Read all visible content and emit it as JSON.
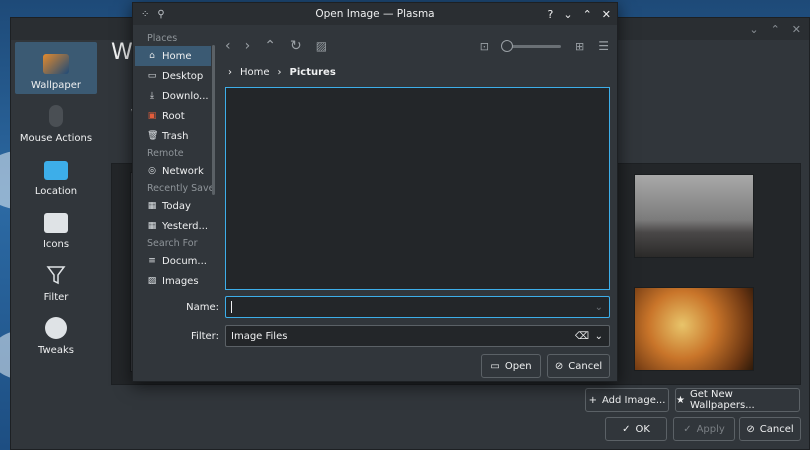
{
  "dialog": {
    "title": "Open Image — Plasma",
    "help_label": "?",
    "places_section": "Places",
    "places": [
      {
        "label": "Home",
        "icon": "home-icon"
      },
      {
        "label": "Desktop",
        "icon": "desktop-icon"
      },
      {
        "label": "Downlo...",
        "icon": "download-icon"
      },
      {
        "label": "Root",
        "icon": "root-folder-icon"
      },
      {
        "label": "Trash",
        "icon": "trash-icon"
      }
    ],
    "remote_section": "Remote",
    "remote": [
      {
        "label": "Network",
        "icon": "network-icon"
      }
    ],
    "recent_section": "Recently Save",
    "recent": [
      {
        "label": "Today",
        "icon": "calendar-icon"
      },
      {
        "label": "Yesterd...",
        "icon": "calendar-icon"
      }
    ],
    "search_section": "Search For",
    "search": [
      {
        "label": "Docum...",
        "icon": "document-icon"
      },
      {
        "label": "Images",
        "icon": "image-icon"
      }
    ],
    "breadcrumb": {
      "home": "Home",
      "current": "Pictures"
    },
    "name_label": "Name:",
    "name_value": "",
    "filter_label": "Filter:",
    "filter_value": "Image Files",
    "open_label": "Open",
    "cancel_label": "Cancel"
  },
  "settings": {
    "sidebar": [
      {
        "label": "Wallpaper",
        "icon": "wallpaper-icon",
        "active": true
      },
      {
        "label": "Mouse Actions",
        "icon": "mouse-icon"
      },
      {
        "label": "Location",
        "icon": "folder-icon"
      },
      {
        "label": "Icons",
        "icon": "icons-icon"
      },
      {
        "label": "Filter",
        "icon": "filter-icon"
      },
      {
        "label": "Tweaks",
        "icon": "tweaks-icon"
      }
    ],
    "heading_partial": "Wa",
    "sub_partial": "W",
    "add_image_label": "Add Image...",
    "get_new_label": "Get New Wallpapers...",
    "ok_label": "OK",
    "apply_label": "Apply",
    "cancel_label": "Cancel"
  },
  "colors": {
    "accent": "#3daee9",
    "window": "#31363b",
    "view": "#232629"
  }
}
